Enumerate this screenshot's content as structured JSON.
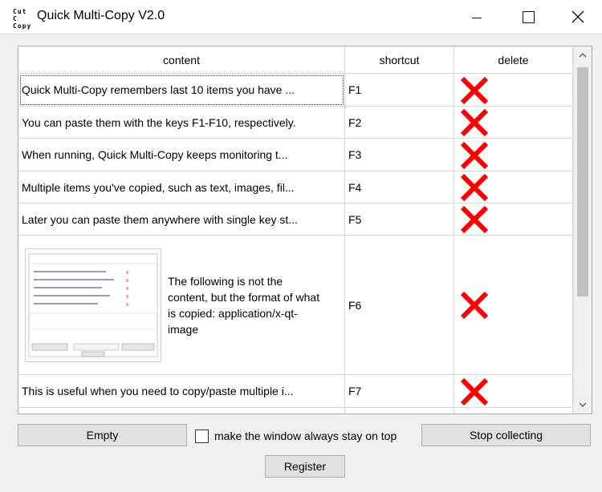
{
  "window": {
    "icon_text_line1": "Cut C",
    "icon_text_line2": "Copy",
    "title": "Quick Multi-Copy V2.0",
    "minimize_icon": "minimize-icon",
    "maximize_icon": "maximize-icon",
    "close_icon": "close-icon"
  },
  "table": {
    "headers": {
      "content": "content",
      "shortcut": "shortcut",
      "delete": "delete"
    },
    "delete_icon": "red-x-icon",
    "delete_color": "#ff0000",
    "rows": [
      {
        "content": "Quick Multi-Copy remembers last 10 items you have ...",
        "shortcut": "F1"
      },
      {
        "content": "You can paste them with the keys F1-F10, respectively.",
        "shortcut": "F2"
      },
      {
        "content": "When running, Quick Multi-Copy keeps monitoring t...",
        "shortcut": "F3"
      },
      {
        "content": "Multiple items you've copied, such as text, images, fil...",
        "shortcut": "F4"
      },
      {
        "content": "Later you can paste them anywhere with single key st...",
        "shortcut": "F5"
      },
      {
        "content": "The following is not the content, but the format of what is copied: application/x-qt-image",
        "shortcut": "F6",
        "has_image": true
      },
      {
        "content": "This is useful when you need to copy/paste multiple i...",
        "shortcut": "F7"
      }
    ]
  },
  "controls": {
    "empty_label": "Empty",
    "always_on_top_label": "make the window always stay on top",
    "always_on_top_checked": false,
    "stop_label": "Stop collecting",
    "register_label": "Register"
  }
}
